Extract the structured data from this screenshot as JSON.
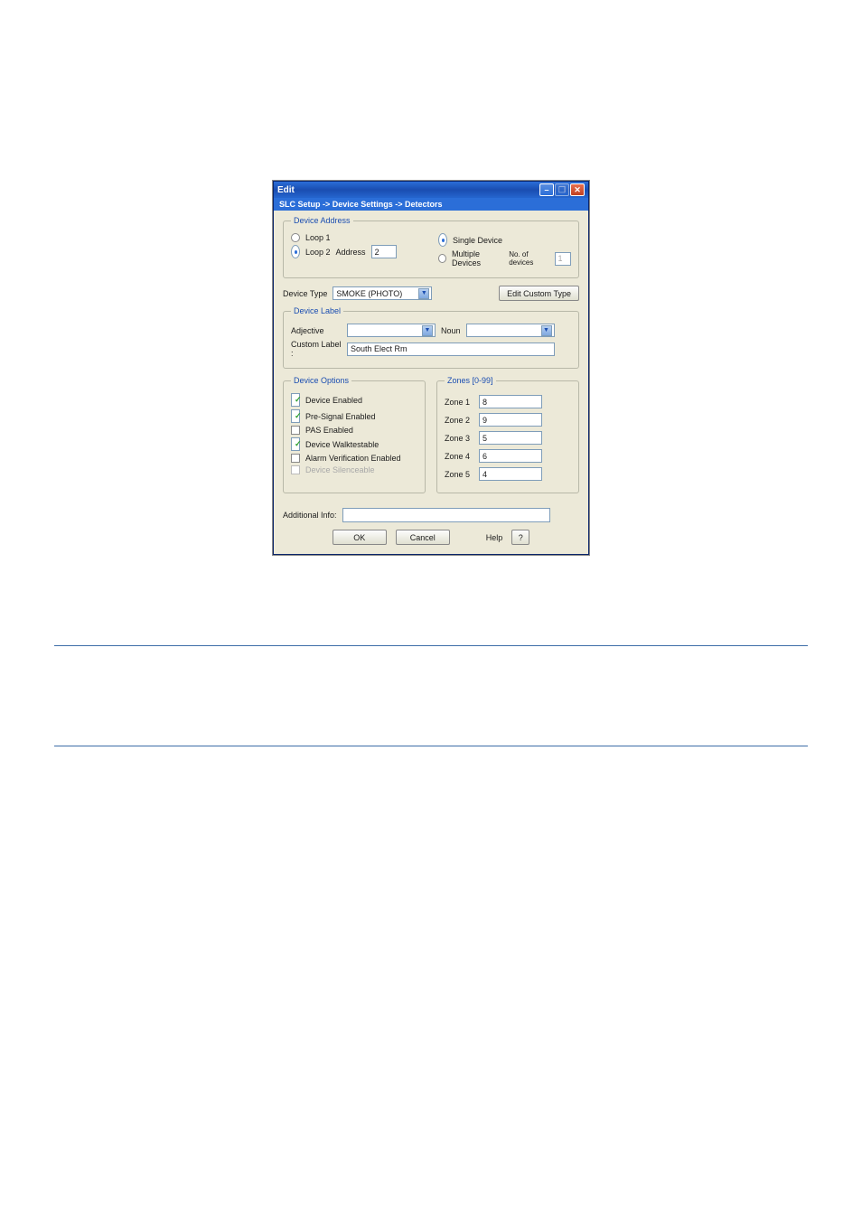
{
  "dialog": {
    "title": "Edit",
    "breadcrumb": "SLC Setup -> Device Settings -> Detectors",
    "deviceAddress": {
      "legend": "Device Address",
      "loop1_label": "Loop 1",
      "loop2_label": "Loop 2",
      "address_label": "Address",
      "address_value": "2",
      "single_label": "Single Device",
      "multiple_label": "Multiple Devices",
      "numdev_label": "No. of devices",
      "numdev_value": "1"
    },
    "deviceType": {
      "label": "Device Type",
      "value": "SMOKE (PHOTO)",
      "edit_custom_btn": "Edit Custom Type"
    },
    "deviceLabel": {
      "legend": "Device Label",
      "adjective_label": "Adjective",
      "adjective_value": "",
      "noun_label": "Noun",
      "noun_value": "",
      "custom_label": "Custom Label :",
      "custom_value": "South Elect Rm"
    },
    "deviceOptions": {
      "legend": "Device Options",
      "opts": [
        "Device Enabled",
        "Pre-Signal Enabled",
        "PAS Enabled",
        "Device Walktestable",
        "Alarm Verification Enabled",
        "Device Silenceable"
      ]
    },
    "zones": {
      "legend": "Zones [0-99]",
      "rows": [
        {
          "label": "Zone 1",
          "value": "8"
        },
        {
          "label": "Zone 2",
          "value": "9"
        },
        {
          "label": "Zone 3",
          "value": "5"
        },
        {
          "label": "Zone 4",
          "value": "6"
        },
        {
          "label": "Zone 5",
          "value": "4"
        }
      ]
    },
    "additional": {
      "label": "Additional Info:",
      "value": ""
    },
    "buttons": {
      "ok": "OK",
      "cancel": "Cancel",
      "help": "Help",
      "q": "?"
    }
  }
}
